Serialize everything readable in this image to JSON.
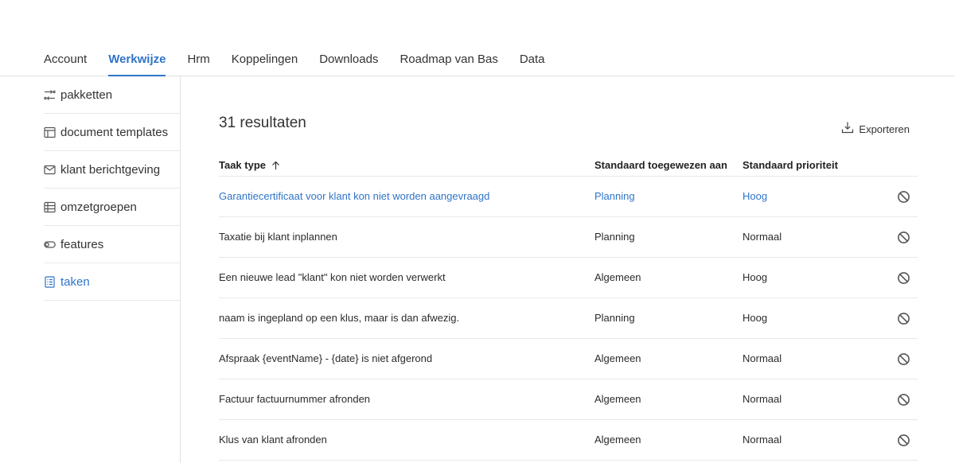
{
  "nav": {
    "tabs": [
      {
        "label": "Account"
      },
      {
        "label": "Werkwijze"
      },
      {
        "label": "Hrm"
      },
      {
        "label": "Koppelingen"
      },
      {
        "label": "Downloads"
      },
      {
        "label": "Roadmap van Bas"
      },
      {
        "label": "Data"
      }
    ],
    "active_tab": "Werkwijze"
  },
  "sidebar": {
    "items": [
      {
        "label": "pakketten",
        "icon": "packages-icon"
      },
      {
        "label": "document templates",
        "icon": "template-icon"
      },
      {
        "label": "klant berichtgeving",
        "icon": "mail-icon"
      },
      {
        "label": "omzetgroepen",
        "icon": "table-icon"
      },
      {
        "label": "features",
        "icon": "toggle-icon"
      },
      {
        "label": "taken",
        "icon": "task-list-icon"
      }
    ],
    "active_item": "taken"
  },
  "main": {
    "result_count": "31 resultaten",
    "export_label": "Exporteren",
    "columns": [
      "Taak type",
      "Standaard toegewezen aan",
      "Standaard prioriteit"
    ],
    "sort_column": "Taak type",
    "sort_direction": "ascending",
    "rows": [
      {
        "task": "Garantiecertificaat voor klant kon niet worden aangevraagd",
        "assigned": "Planning",
        "priority": "Hoog"
      },
      {
        "task": "Taxatie bij klant inplannen",
        "assigned": "Planning",
        "priority": "Normaal"
      },
      {
        "task": "Een nieuwe lead \"klant\" kon niet worden verwerkt",
        "assigned": "Algemeen",
        "priority": "Hoog"
      },
      {
        "task": "naam is ingepland op een klus, maar is dan afwezig.",
        "assigned": "Planning",
        "priority": "Hoog"
      },
      {
        "task": "Afspraak {eventName} - {date} is niet afgerond",
        "assigned": "Algemeen",
        "priority": "Normaal"
      },
      {
        "task": "Factuur factuurnummer afronden",
        "assigned": "Algemeen",
        "priority": "Normaal"
      },
      {
        "task": "Klus van klant afronden",
        "assigned": "Algemeen",
        "priority": "Normaal"
      }
    ]
  },
  "colors": {
    "accent": "#2f74c9",
    "border": "#e2e2e2",
    "text": "#2b2b2b"
  }
}
